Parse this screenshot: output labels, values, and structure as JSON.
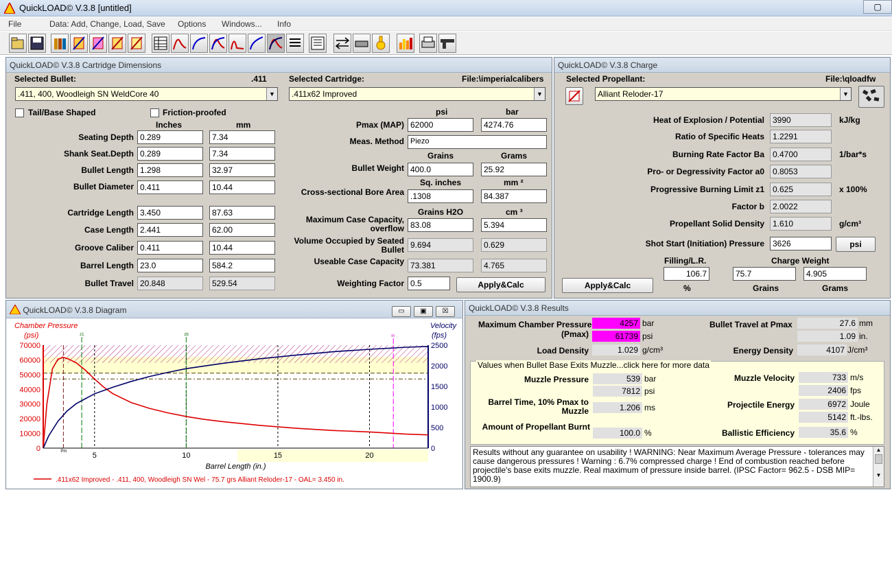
{
  "window": {
    "title": "QuickLOAD© V.3.8   [untitled]"
  },
  "menu": [
    "File",
    "Data: Add, Change, Load, Save",
    "Options",
    "Windows...",
    "Info"
  ],
  "toolbar_icons": [
    "open-file-icon",
    "save-icon",
    "bullet-db-icon",
    "edit-bullet-icon",
    "edit-cartridge-icon",
    "edit-powder-icon",
    "edit-load-icon",
    "table-icon",
    "pressure-curve-icon",
    "velocity-curve-icon",
    "combined-curve-icon",
    "pressure-peak-icon",
    "velocity-peak-icon",
    "diagram-active-icon",
    "list-icon",
    "numbered-list-icon",
    "compare-icon",
    "conditions-icon",
    "temperature-icon",
    "bar-chart-icon",
    "print-icon",
    "gun-icon"
  ],
  "cartridge": {
    "title": "QuickLOAD© V.3.8 Cartridge Dimensions",
    "selected_bullet_label": "Selected Bullet:",
    "bullet_diameter_short": ".411",
    "selected_bullet": ".411, 400, Woodleigh SN WeldCore 40",
    "selected_cartridge_label": "Selected Cartridge:",
    "cartridge_file": "File:\\imperialcalibers",
    "selected_cartridge": ".411x62 Improved",
    "tail_base": "Tail/Base Shaped",
    "friction": "Friction-proofed",
    "col_inches": "Inches",
    "col_mm": "mm",
    "rows": [
      {
        "label": "Seating Depth",
        "in": "0.289",
        "mm": "7.34"
      },
      {
        "label": "Shank Seat.Depth",
        "in": "0.289",
        "mm": "7.34"
      },
      {
        "label": "Bullet Length",
        "in": "1.298",
        "mm": "32.97"
      },
      {
        "label": "Bullet Diameter",
        "in": "0.411",
        "mm": "10.44"
      },
      {
        "label": "Cartridge Length",
        "in": "3.450",
        "mm": "87.63"
      },
      {
        "label": "Case Length",
        "in": "2.441",
        "mm": "62.00"
      },
      {
        "label": "Groove Caliber",
        "in": "0.411",
        "mm": "10.44"
      },
      {
        "label": "Barrel Length",
        "in": "23.0",
        "mm": "584.2"
      },
      {
        "label": "Bullet Travel",
        "in": "20.848",
        "mm": "529.54"
      }
    ],
    "col_psi": "psi",
    "col_bar": "bar",
    "pmax_label": "Pmax (MAP)",
    "pmax_psi": "62000",
    "pmax_bar": "4274.76",
    "meas_label": "Meas. Method",
    "meas_value": "Piezo",
    "col_grains": "Grains",
    "col_grams": "Grams",
    "bw_label": "Bullet Weight",
    "bw_grains": "400.0",
    "bw_grams": "25.92",
    "col_sqin": "Sq. inches",
    "col_mm2": "mm ²",
    "bore_label": "Cross-sectional Bore Area",
    "bore_sqin": ".1308",
    "bore_mm2": "84.387",
    "col_h2o": "Grains H2O",
    "col_cm3": "cm ³",
    "maxcap_label1": "Maximum Case Capacity,",
    "maxcap_label2": "overflow",
    "maxcap_gr": "83.08",
    "maxcap_cm": "5.394",
    "volseat_label1": "Volume Occupied by Seated",
    "volseat_label2": "Bullet",
    "volseat_gr": "9.694",
    "volseat_cm": "0.629",
    "useable_label": "Useable Case Capacity",
    "useable_gr": "73.381",
    "useable_cm": "4.765",
    "wf_label": "Weighting Factor",
    "wf_value": "0.5",
    "apply": "Apply&Calc"
  },
  "charge": {
    "title": "QuickLOAD© V.3.8 Charge",
    "prop_label": "Selected Propellant:",
    "prop_file": "File:\\qloadfw",
    "propellant": "Alliant Reloder-17",
    "rows": [
      {
        "label": "Heat of Explosion / Potential",
        "value": "3990",
        "unit": "kJ/kg"
      },
      {
        "label": "Ratio of Specific Heats",
        "value": "1.2291",
        "unit": ""
      },
      {
        "label": "Burning Rate Factor  Ba",
        "value": "0.4700",
        "unit": "1/bar*s"
      },
      {
        "label": "Pro- or Degressivity Factor  a0",
        "value": "0.8053",
        "unit": ""
      },
      {
        "label": "Progressive Burning Limit z1",
        "value": "0.625",
        "unit": "x 100%"
      },
      {
        "label": "Factor  b",
        "value": "2.0022",
        "unit": ""
      },
      {
        "label": "Propellant Solid Density",
        "value": "1.610",
        "unit": "g/cm³"
      }
    ],
    "shot_label": "Shot Start (Initiation) Pressure",
    "shot_value": "3626",
    "shot_unit": "psi",
    "fill_label": "Filling/L.R.",
    "charge_label": "Charge Weight",
    "fill_value": "106.7",
    "grains_value": "75.7",
    "grams_value": "4.905",
    "pct": "%",
    "grains": "Grains",
    "grams": "Grams",
    "apply": "Apply&Calc"
  },
  "diagram": {
    "title": "QuickLOAD© V.3.8 Diagram",
    "legend": ".411x62 Improved - .411, 400, Woodleigh SN Wel - 75.7 grs Alliant Reloder-17 - OAL= 3.450 in."
  },
  "chart_data": {
    "type": "line",
    "xlabel": "Barrel Length (in.)",
    "ylabel_left": "Chamber Pressure",
    "ylabel_left_unit": "(psi)",
    "ylabel_right": "Velocity",
    "ylabel_right_unit": "(fps)",
    "xlim": [
      2.2,
      23.2
    ],
    "ylim_left": [
      0,
      70000
    ],
    "ylim_right": [
      0,
      2500
    ],
    "x_ticks": [
      5,
      10,
      15,
      20
    ],
    "y_ticks_left": [
      0,
      10000,
      20000,
      30000,
      40000,
      50000,
      60000,
      70000
    ],
    "y_ticks_right": [
      0,
      500,
      1000,
      1500,
      2000,
      2500
    ],
    "markers": [
      "z1",
      "zb",
      "m",
      "Pm"
    ],
    "series": [
      {
        "axis": "left",
        "color": "#dd0000",
        "x": [
          2.2,
          2.4,
          2.7,
          3.0,
          3.3,
          3.6,
          4.0,
          4.5,
          5.0,
          5.5,
          6.0,
          7.0,
          8.0,
          9.0,
          10.0,
          11.0,
          12.0,
          14.0,
          16.0,
          18.0,
          20.0,
          22.0,
          23.2
        ],
        "y": [
          0,
          30000,
          54000,
          60500,
          61739,
          60500,
          58000,
          53000,
          47000,
          41500,
          37000,
          31000,
          27000,
          24000,
          21500,
          19500,
          18000,
          15500,
          13500,
          12000,
          11000,
          9500,
          9000
        ]
      },
      {
        "axis": "right",
        "color": "#000066",
        "x": [
          2.2,
          2.5,
          3.0,
          3.5,
          4.0,
          5.0,
          6.0,
          7.0,
          8.0,
          9.0,
          10.0,
          12.0,
          14.0,
          16.0,
          18.0,
          20.0,
          22.0,
          23.2
        ],
        "y": [
          0,
          300,
          650,
          900,
          1080,
          1320,
          1480,
          1620,
          1740,
          1840,
          1930,
          2060,
          2170,
          2260,
          2340,
          2400,
          2450,
          2470
        ]
      }
    ]
  },
  "results": {
    "title": "QuickLOAD© V.3.8 Results",
    "mcp_label1": "Maximum Chamber Pressure",
    "mcp_label2": "(Pmax)",
    "mcp_bar": "4257",
    "mcp_psi": "61739",
    "bar": "bar",
    "psi": "psi",
    "btp_label": "Bullet Travel at Pmax",
    "btp_mm": "27.6",
    "btp_in": "1.09",
    "mm": "mm",
    "in": "in.",
    "ld_label": "Load Density",
    "ld_value": "1.029",
    "ld_unit": "g/cm³",
    "ed_label": "Energy Density",
    "ed_value": "4107",
    "ed_unit": "J/cm³",
    "muzzle_header": "Values when Bullet Base Exits Muzzle...click here for more data",
    "mp_label": "Muzzle Pressure",
    "mp_bar": "539",
    "mp_psi": "7812",
    "mv_label": "Muzzle Velocity",
    "mv_ms": "733",
    "mv_fps": "2406",
    "ms": "m/s",
    "fps": "fps",
    "bt_label1": "Barrel Time, 10% Pmax to",
    "bt_label2": "Muzzle",
    "bt_value": "1.206",
    "bt_unit": "ms",
    "pe_label": "Projectile Energy",
    "pe_joule": "6972",
    "pe_ftlbs": "5142",
    "joule": "Joule",
    "ftlbs": "ft.-lbs.",
    "apb_label": "Amount of Propellant Burnt",
    "apb_value": "100.0",
    "pct": "%",
    "be_label": "Ballistic Efficiency",
    "be_value": "35.6",
    "warning": "Results without any guarantee on usability !  WARNING: Near Maximum Average Pressure - tolerances may cause dangerous pressures !  Warning : 6.7% compressed charge !  End of combustion reached before projectile's base exits muzzle.  Real maximum of pressure inside barrel.  (IPSC Factor= 962.5 - DSB MIP= 1900.9)"
  }
}
